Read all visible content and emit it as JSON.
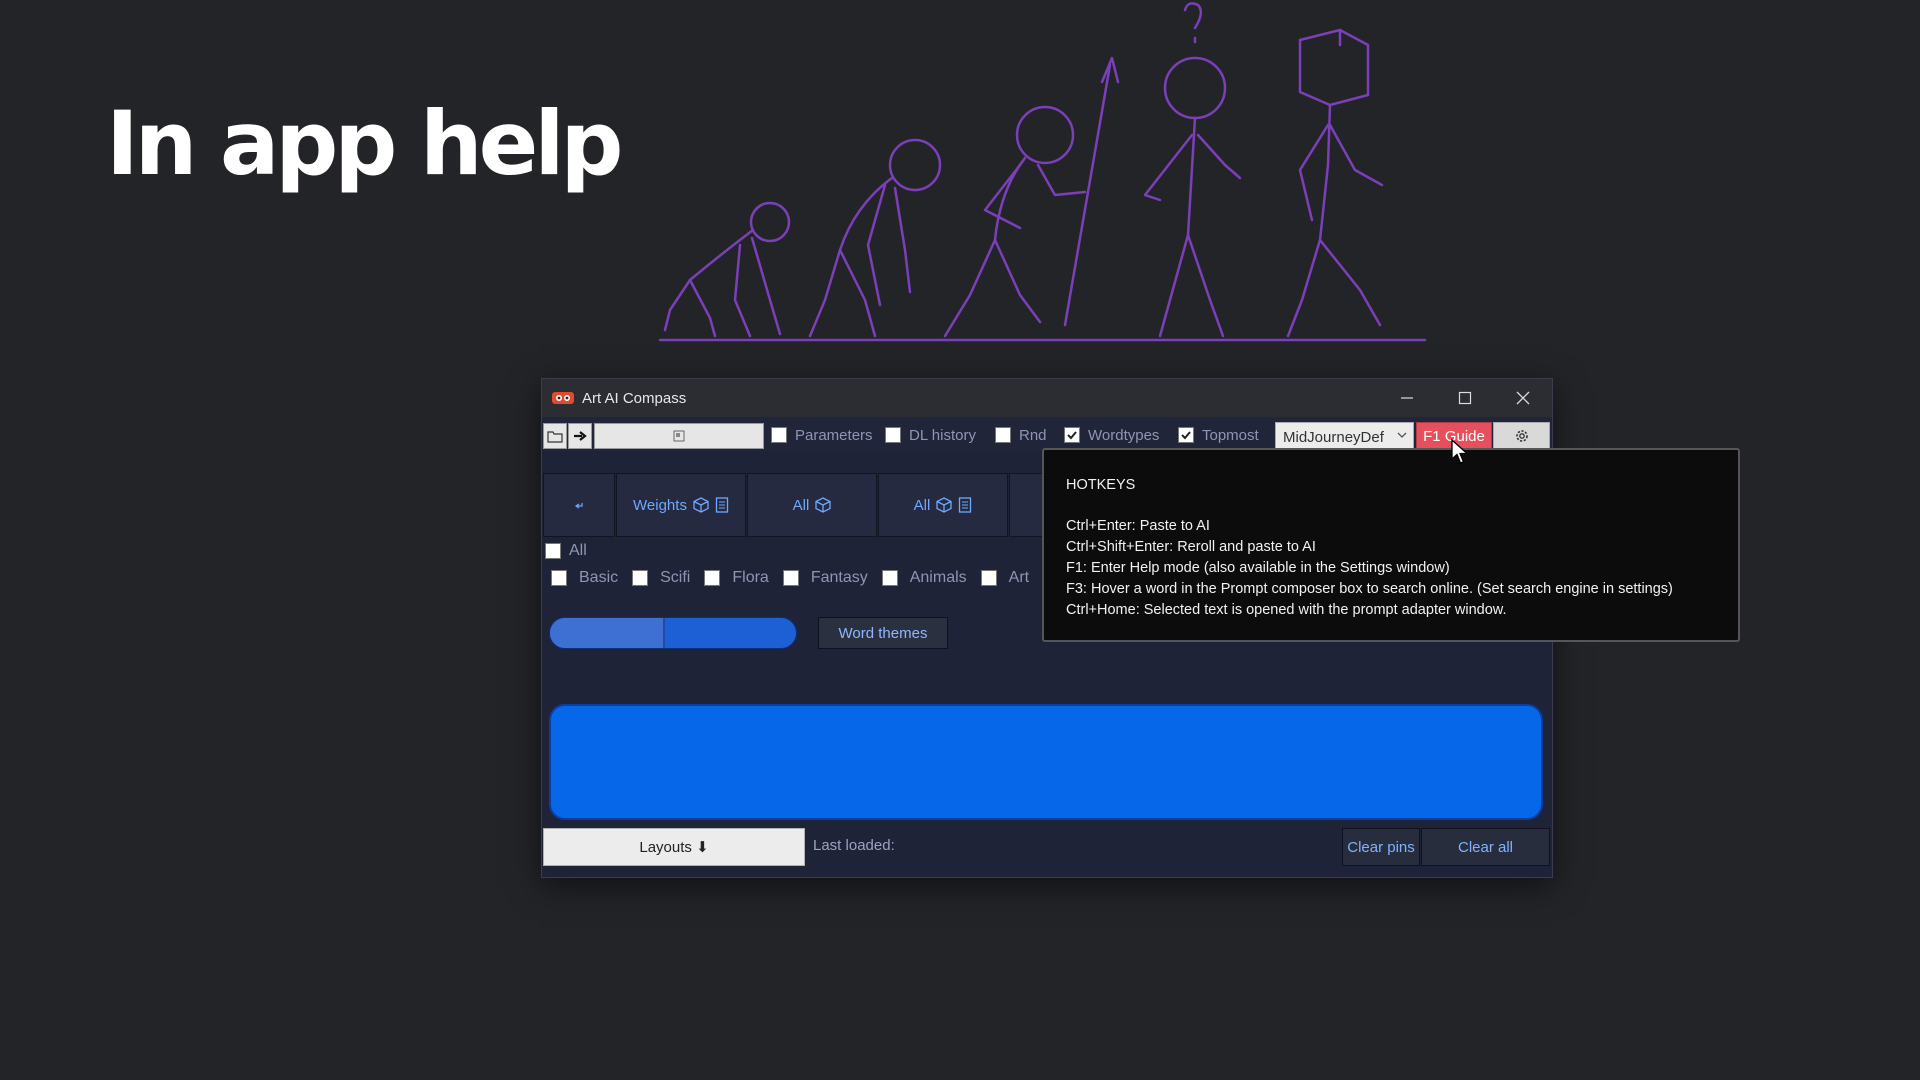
{
  "slide": {
    "title": "In app help"
  },
  "window": {
    "title": "Art AI Compass",
    "controls": {
      "minimize": "minimize",
      "maximize": "maximize",
      "close": "close"
    }
  },
  "toolbar": {
    "checkboxes": [
      {
        "label": "Parameters",
        "checked": false
      },
      {
        "label": "DL history",
        "checked": false
      },
      {
        "label": "Rnd",
        "checked": false
      },
      {
        "label": "Wordtypes",
        "checked": true
      },
      {
        "label": "Topmost",
        "checked": true
      }
    ],
    "model_select": "MidJourneyDef",
    "f1_button": "F1 Guide",
    "icons": [
      "folder-icon",
      "arrow-right-icon",
      "panel-icon",
      "gear-icon"
    ]
  },
  "categories": [
    {
      "label": ""
    },
    {
      "label": "Weights"
    },
    {
      "label": "All"
    },
    {
      "label": "All"
    }
  ],
  "themes": {
    "all_label": "All",
    "items": [
      "Basic",
      "Scifi",
      "Flora",
      "Fantasy",
      "Animals",
      "Art"
    ]
  },
  "slider": {
    "value": 0.46
  },
  "word_themes_button": "Word themes",
  "bottom": {
    "layouts": "Layouts ⬇",
    "last_loaded": "Last loaded:",
    "clear_pins": "Clear pins",
    "clear_all": "Clear all"
  },
  "tooltip": {
    "title": "HOTKEYS",
    "lines": [
      "Ctrl+Enter: Paste to AI",
      "Ctrl+Shift+Enter: Reroll and paste to AI",
      "F1: Enter Help mode (also available in the Settings window)",
      "F3: Hover a word in the Prompt composer box to search online. (Set search engine in settings)",
      "Ctrl+Home: Selected text is opened with the prompt adapter window."
    ]
  },
  "colors": {
    "background": "#232428",
    "window_body": "#1e2338",
    "accent_blue": "#0668e8",
    "f1_red": "#e6505c",
    "illustration": "#7b3fb8"
  }
}
